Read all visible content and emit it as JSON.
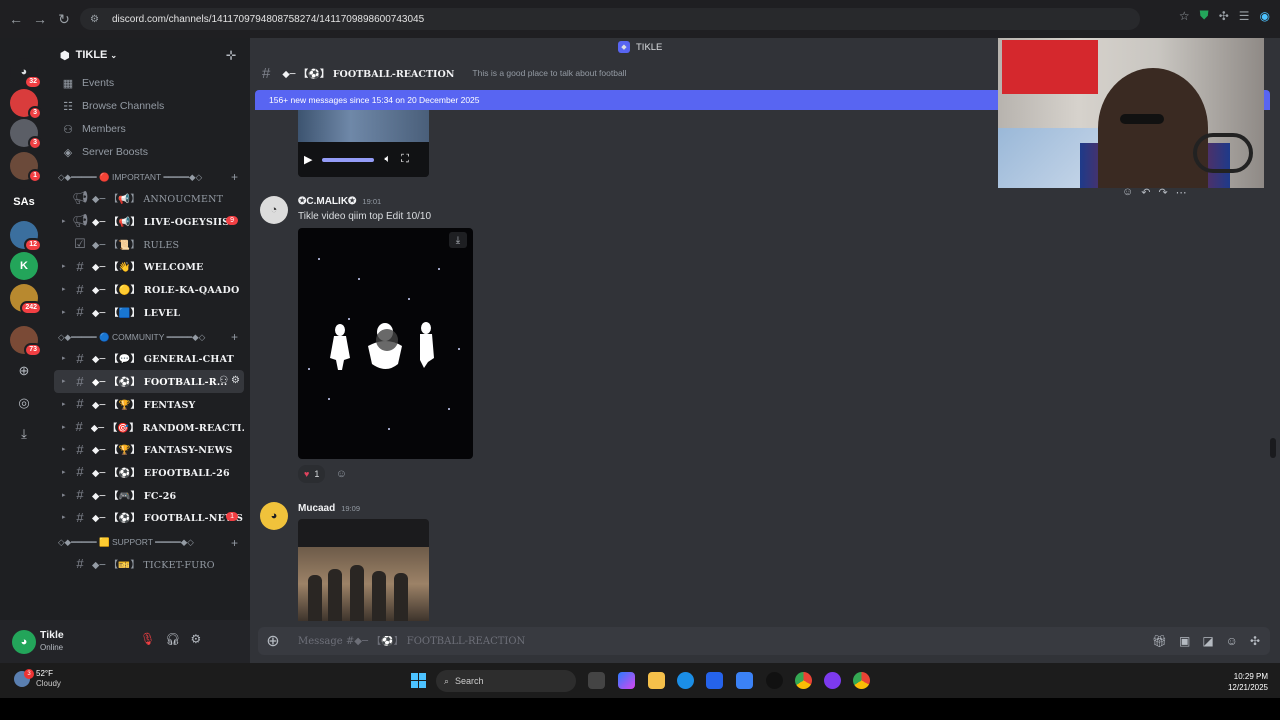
{
  "browser": {
    "url": "discord.com/channels/1411709794808758274/1411709898600743045",
    "topbar_title": "TIKLE"
  },
  "guilds": {
    "home_badge": "32",
    "items": [
      {
        "label": "",
        "badge": "3",
        "color": "#d93c3c"
      },
      {
        "label": "",
        "badge": "3",
        "color": "#5b5e66"
      },
      {
        "label": "",
        "badge": "1",
        "color": "#6b4a3a"
      },
      {
        "label": "SAs",
        "badge": "",
        "color": "#1e1f22"
      },
      {
        "label": "",
        "badge": "12",
        "color": "#3b6f9e"
      },
      {
        "label": "K",
        "badge": "",
        "color": "#23a55a"
      },
      {
        "label": "",
        "badge": "242",
        "color": "#b8892f"
      },
      {
        "label": "",
        "badge": "73",
        "color": "#7a4a36"
      }
    ]
  },
  "server": {
    "name": "TIKLE",
    "nav": [
      {
        "icon": "calendar",
        "label": "Events"
      },
      {
        "icon": "browse",
        "label": "Browse Channels"
      },
      {
        "icon": "members",
        "label": "Members"
      },
      {
        "icon": "boost",
        "label": "Server Boosts"
      }
    ],
    "categories": [
      {
        "label": "◇◆━━━━━ 🔴 IMPORTANT ━━━━━◆◇"
      },
      {
        "label": "◇◆━━━━━ 🔵 COMMUNITY ━━━━━◆◇"
      },
      {
        "label": "◇◆━━━━━ 🟨 SUPPORT ━━━━━◆◇"
      }
    ],
    "channels_important": [
      {
        "prefix": "◆─ 【📢】",
        "name": "ANNOUCMENT",
        "state": "read",
        "icon": "📢",
        "badge": ""
      },
      {
        "prefix": "◆─ 【📢】",
        "name": "LIVE-OGEYSIIS",
        "state": "unread",
        "icon": "📢",
        "badge": "9"
      },
      {
        "prefix": "◆─ 【📜】",
        "name": "RULES",
        "state": "read",
        "icon": "☑",
        "badge": ""
      },
      {
        "prefix": "◆─ 【👋】",
        "name": "WELCOME",
        "state": "unread",
        "icon": "#",
        "badge": ""
      },
      {
        "prefix": "◆─ 【🟡】",
        "name": "ROLE-KA-QAADO",
        "state": "unread",
        "icon": "#",
        "badge": ""
      },
      {
        "prefix": "◆─ 【🟦】",
        "name": "LEVEL",
        "state": "unread",
        "icon": "#",
        "badge": ""
      }
    ],
    "channels_community": [
      {
        "prefix": "◆─ 【💬】",
        "name": "GENERAL-CHAT",
        "state": "unread",
        "badge": ""
      },
      {
        "prefix": "◆─ 【⚽】",
        "name": "FOOTBALL-R...",
        "state": "active",
        "badge": ""
      },
      {
        "prefix": "◆─ 【🏆】",
        "name": "FENTASY",
        "state": "unread",
        "badge": ""
      },
      {
        "prefix": "◆─ 【🎯】",
        "name": "RANDOM-REACTI...",
        "state": "unread",
        "badge": ""
      },
      {
        "prefix": "◆─ 【🏆】",
        "name": "FANTASY-NEWS",
        "state": "unread",
        "badge": ""
      },
      {
        "prefix": "◆─ 【⚽】",
        "name": "EFOOTBALL-26",
        "state": "unread",
        "badge": ""
      },
      {
        "prefix": "◆─ 【🎮】",
        "name": "FC-26",
        "state": "unread",
        "badge": ""
      },
      {
        "prefix": "◆─ 【⚽】",
        "name": "FOOTBALL-NEWS",
        "state": "unread",
        "badge": "1"
      }
    ],
    "channels_support": [
      {
        "prefix": "◆─ 【🎫】",
        "name": "TICKET-FURO",
        "state": "read",
        "badge": ""
      }
    ]
  },
  "user": {
    "name": "Tikle",
    "status": "Online"
  },
  "channel": {
    "name": "◆─ 【⚽】 FOOTBALL-REACTION",
    "topic": "This is a good place to talk about football",
    "new_messages": "156+ new messages since 15:34 on 20 December 2025"
  },
  "messages": [
    {
      "author": "✪C.MALIK✪",
      "time": "19:01",
      "text": "Tikle video qiim top Edit 10/10",
      "reaction_count": "1"
    },
    {
      "author": "Mucaad",
      "time": "19:09",
      "text": ""
    }
  ],
  "composer": {
    "placeholder": "Message #◆─ 【⚽】 FOOTBALL-REACTION"
  },
  "taskbar": {
    "temp": "52°F",
    "condition": "Cloudy",
    "weather_badge": "3",
    "search_label": "Search",
    "time": "10:29 PM",
    "date": "12/21/2025"
  }
}
